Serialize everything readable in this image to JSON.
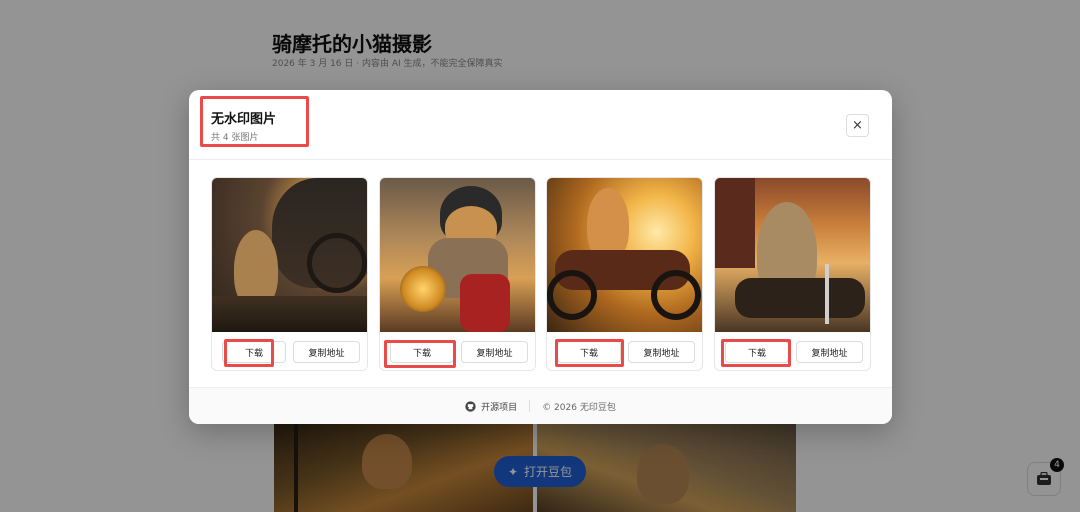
{
  "page": {
    "title": "骑摩托的小猫摄影",
    "meta": "2026 年 3 月 16 日 · 内容由 AI 生成，不能完全保障真实",
    "open_doubao_label": "打开豆包",
    "cart_count": "4"
  },
  "modal": {
    "title": "无水印图片",
    "subtitle": "共 4 张图片",
    "close_label": "×",
    "cards": [
      {
        "download_label": "下载",
        "copy_label": "复制地址"
      },
      {
        "download_label": "下载",
        "copy_label": "复制地址"
      },
      {
        "download_label": "下载",
        "copy_label": "复制地址"
      },
      {
        "download_label": "下载",
        "copy_label": "复制地址"
      }
    ],
    "footer": {
      "github_label": "开源项目",
      "copyright": "© 2026 无印豆包"
    }
  },
  "colors": {
    "highlight": "#e94b4b",
    "primary_button": "#1f5fd6"
  },
  "icons": [
    "github-icon",
    "sparkle-icon",
    "cart-icon",
    "close-icon"
  ]
}
